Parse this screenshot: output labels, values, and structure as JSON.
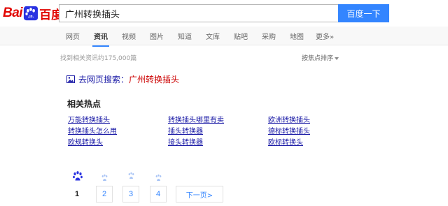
{
  "header": {
    "logo_latin": "Bai",
    "logo_cn": "百度",
    "search_value": "广州转换插头",
    "search_button": "百度一下"
  },
  "tabs": [
    {
      "label": "网页",
      "active": false
    },
    {
      "label": "资讯",
      "active": true
    },
    {
      "label": "视频",
      "active": false
    },
    {
      "label": "图片",
      "active": false
    },
    {
      "label": "知道",
      "active": false
    },
    {
      "label": "文库",
      "active": false
    },
    {
      "label": "贴吧",
      "active": false
    },
    {
      "label": "采购",
      "active": false
    },
    {
      "label": "地图",
      "active": false
    },
    {
      "label": "更多»",
      "active": false
    }
  ],
  "results": {
    "count_text": "找到相关资讯约175,000篇",
    "sort_label": "按焦点排序"
  },
  "web_search": {
    "prefix": "去网页搜索：",
    "query": "广州转换插头"
  },
  "related": {
    "title": "相关热点",
    "items": [
      "万能转换插头",
      "转换插头哪里有卖",
      "欧洲转换插头",
      "转换插头怎么用",
      "插头转换器",
      "德标转换插头",
      "欧规转换头",
      "接头转换器",
      "欧标转换头"
    ]
  },
  "pager": {
    "current": "1",
    "pages": [
      "2",
      "3",
      "4"
    ],
    "next_label": "下一页>"
  },
  "colors": {
    "brand_red": "#e10602",
    "brand_blue": "#3385ff",
    "link": "#1a1aa6"
  }
}
